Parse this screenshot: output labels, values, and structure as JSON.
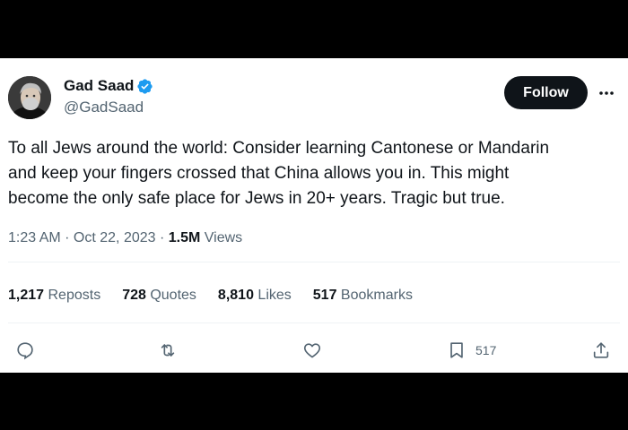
{
  "author": {
    "name": "Gad Saad",
    "handle": "@GadSaad",
    "verified_icon": "verified-badge-icon",
    "avatar_icon": "avatar"
  },
  "follow": {
    "label": "Follow"
  },
  "more": {
    "label": "···"
  },
  "tweet": {
    "text": "To all Jews around the world:  Consider learning Cantonese or Mandarin\nand keep your fingers crossed that China allows you in.  This might\nbecome the only safe place for Jews in 20+ years.  Tragic but true."
  },
  "meta": {
    "time": "1:23 AM · Oct 22, 2023 · ",
    "views_count": "1.5M",
    "views_label": " Views"
  },
  "stats": [
    {
      "count": "1,217",
      "label": " Reposts"
    },
    {
      "count": "728",
      "label": " Quotes"
    },
    {
      "count": "8,810",
      "label": " Likes"
    },
    {
      "count": "517",
      "label": " Bookmarks"
    }
  ],
  "actions": {
    "reply_icon": "reply-icon",
    "repost_icon": "repost-icon",
    "like_icon": "like-icon",
    "bookmark_icon": "bookmark-icon",
    "bookmark_count": "517",
    "share_icon": "share-icon"
  },
  "colors": {
    "background": "#000000",
    "card": "#ffffff",
    "text": "#0f1419",
    "secondary": "#536471",
    "verified": "#1d9bf0",
    "follow_bg": "#0f1419"
  }
}
